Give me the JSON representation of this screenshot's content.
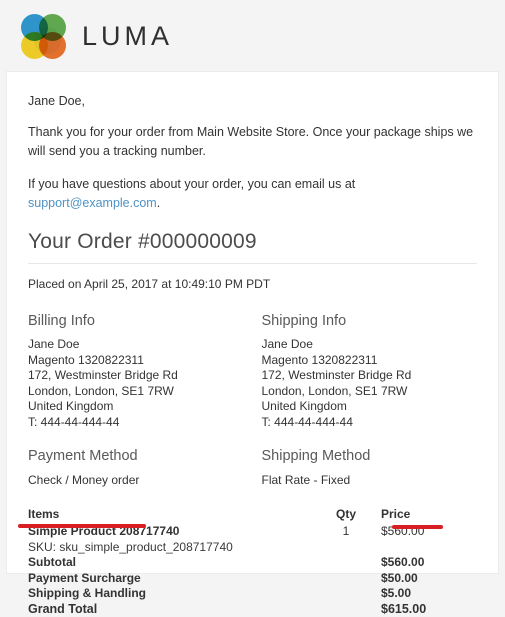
{
  "header": {
    "logo_text": "LUMA",
    "logo_icon": "luma-circles-logo",
    "logo_colors": {
      "blue": "#1f92d0",
      "green": "#56a944",
      "orange": "#ec6a1e",
      "yellow": "#f7d117"
    }
  },
  "intro": {
    "greeting": "Jane Doe,",
    "paragraph_1": "Thank you for your order from Main Website Store. Once your package ships we will send you a tracking number.",
    "paragraph_2_prefix": "If you have questions about your order, you can email us at ",
    "support_email": "support@example.com",
    "paragraph_2_suffix": ".",
    "link_color": "#4f93c6"
  },
  "order": {
    "title": "Your Order #000000009",
    "placed_on": "Placed on April 25, 2017 at 10:49:10 PM PDT"
  },
  "billing": {
    "title": "Billing Info",
    "lines": [
      "Jane Doe",
      "Magento 1320822311",
      "172, Westminster Bridge Rd",
      "London, London, SE1 7RW",
      "United Kingdom",
      "T: 444-44-444-44"
    ]
  },
  "shipping": {
    "title": "Shipping Info",
    "lines": [
      "Jane Doe",
      "Magento 1320822311",
      "172, Westminster Bridge Rd",
      "London, London, SE1 7RW",
      "United Kingdom",
      "T: 444-44-444-44"
    ]
  },
  "payment_method": {
    "title": "Payment Method",
    "value": "Check / Money order"
  },
  "shipping_method": {
    "title": "Shipping Method",
    "value": "Flat Rate - Fixed"
  },
  "items_table": {
    "columns": {
      "items": "Items",
      "qty": "Qty",
      "price": "Price"
    },
    "rows": [
      {
        "name": "Simple Product 208717740",
        "qty": "1",
        "price": "$560.00",
        "sku": "SKU: sku_simple_product_208717740"
      }
    ]
  },
  "totals": {
    "rows": [
      {
        "label": "Subtotal",
        "value": "$560.00"
      },
      {
        "label": "Payment Surcharge",
        "value": "$50.00"
      },
      {
        "label": "Shipping & Handling",
        "value": "$5.00"
      },
      {
        "label": "Grand Total",
        "value": "$615.00"
      }
    ]
  },
  "annotations": {
    "color": "#d81f23",
    "marks": [
      {
        "name": "payment-surcharge-label-underline"
      },
      {
        "name": "payment-surcharge-value-underline"
      }
    ]
  }
}
